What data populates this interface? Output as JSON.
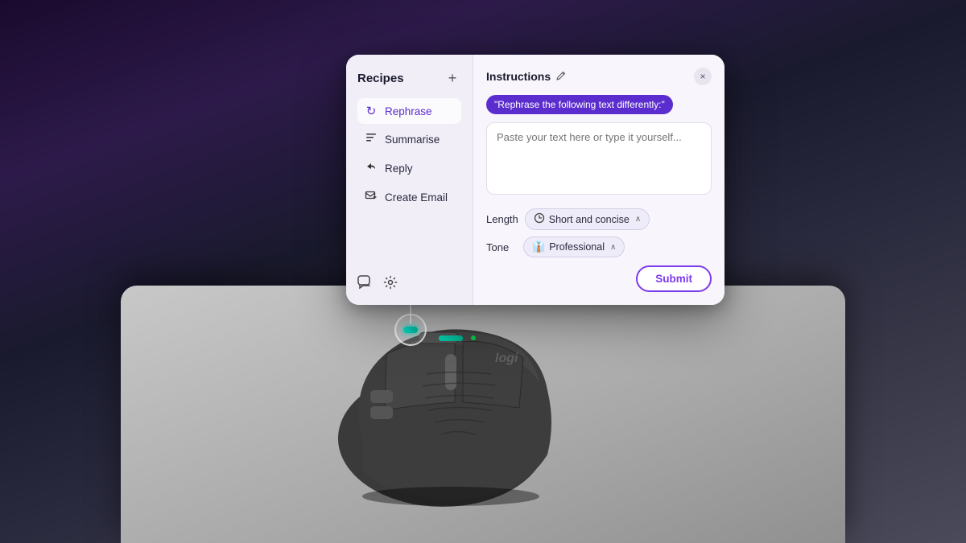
{
  "background": {
    "gradient_desc": "dark purple to dark blue-gray"
  },
  "popup": {
    "recipes_panel": {
      "title": "Recipes",
      "add_button_label": "+",
      "items": [
        {
          "id": "rephrase",
          "label": "Rephrase",
          "icon": "↻",
          "active": true
        },
        {
          "id": "summarise",
          "label": "Summarise",
          "icon": "≡"
        },
        {
          "id": "reply",
          "label": "Reply",
          "icon": "↩"
        },
        {
          "id": "create-email",
          "label": "Create Email",
          "icon": "✉"
        }
      ],
      "footer_icons": [
        {
          "id": "chat",
          "icon": "💬"
        },
        {
          "id": "settings",
          "icon": "⚙"
        }
      ]
    },
    "instructions_panel": {
      "title": "Instructions",
      "edit_icon": "✏",
      "close_icon": "×",
      "prompt_badge": "\"Rephrase the following text differently:\"",
      "textarea_placeholder": "Paste your text here or type it yourself...",
      "length_option": {
        "label": "Length",
        "icon": "🕐",
        "value": "Short and concise",
        "chevron": "∧"
      },
      "tone_option": {
        "label": "Tone",
        "icon": "👔",
        "value": "Professional",
        "chevron": "∧"
      },
      "submit_button": "Submit"
    }
  },
  "connector": {
    "line_desc": "vertical connector line from popup to mouse"
  }
}
